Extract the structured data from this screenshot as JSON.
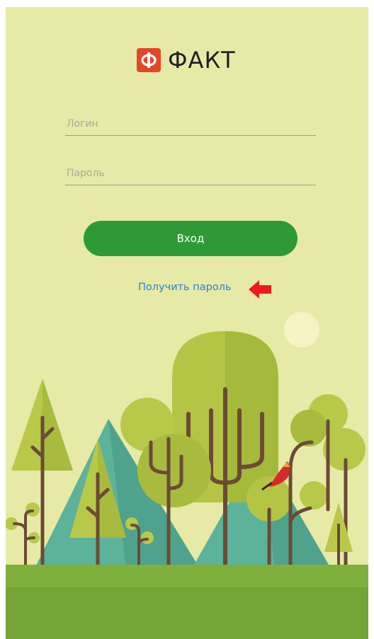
{
  "app": {
    "logo_text": "ФАКТ",
    "logo_icon": "fakt-logo-icon",
    "brand_color": "#e2472a"
  },
  "login_form": {
    "login_placeholder": "Логин",
    "password_placeholder": "Пароль",
    "login_value": "",
    "password_value": "",
    "submit_label": "Вход",
    "submit_color": "#2e9a35"
  },
  "get_password": {
    "label": "Получить пароль",
    "link_color": "#2f7fd6",
    "annotation_icon": "red-arrow-icon"
  },
  "illustration": {
    "name": "forest-illustration",
    "background": "#e6eaa6",
    "grass": "#7fb03b"
  }
}
